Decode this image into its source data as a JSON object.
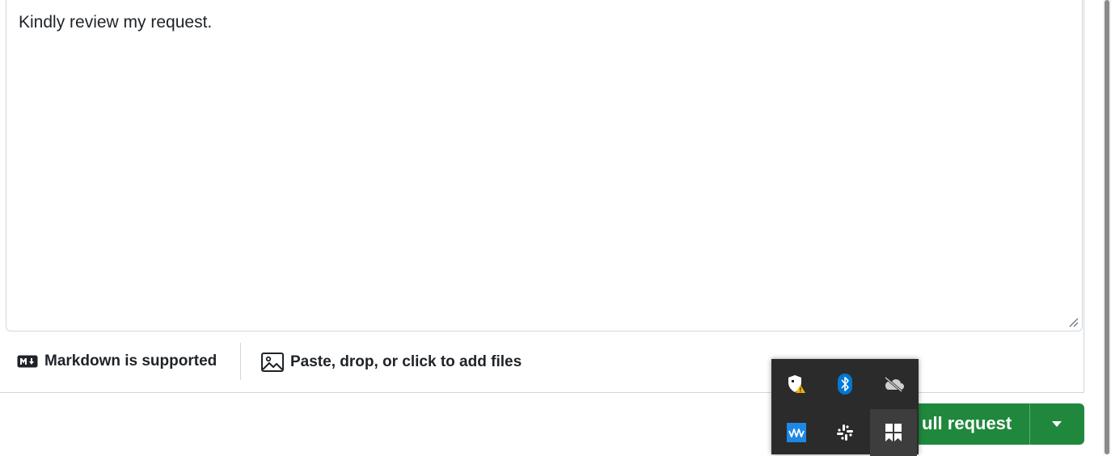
{
  "comment": {
    "text": "Kindly review my request."
  },
  "toolbar": {
    "markdown_label": "Markdown is supported",
    "markdown_badge": "M↓",
    "attach_label": "Paste, drop, or click to add files"
  },
  "submit": {
    "label": "ull request"
  },
  "tray": {
    "icons": [
      "windows-security-warning-icon",
      "bluetooth-icon",
      "onedrive-offline-icon",
      "waves-app-icon",
      "slack-icon",
      "app-grid-icon"
    ]
  },
  "colors": {
    "primary_green": "#1f883d",
    "border": "#d0d7de",
    "tray_bg": "#2b2b2b",
    "bluetooth_blue": "#0078d4"
  }
}
